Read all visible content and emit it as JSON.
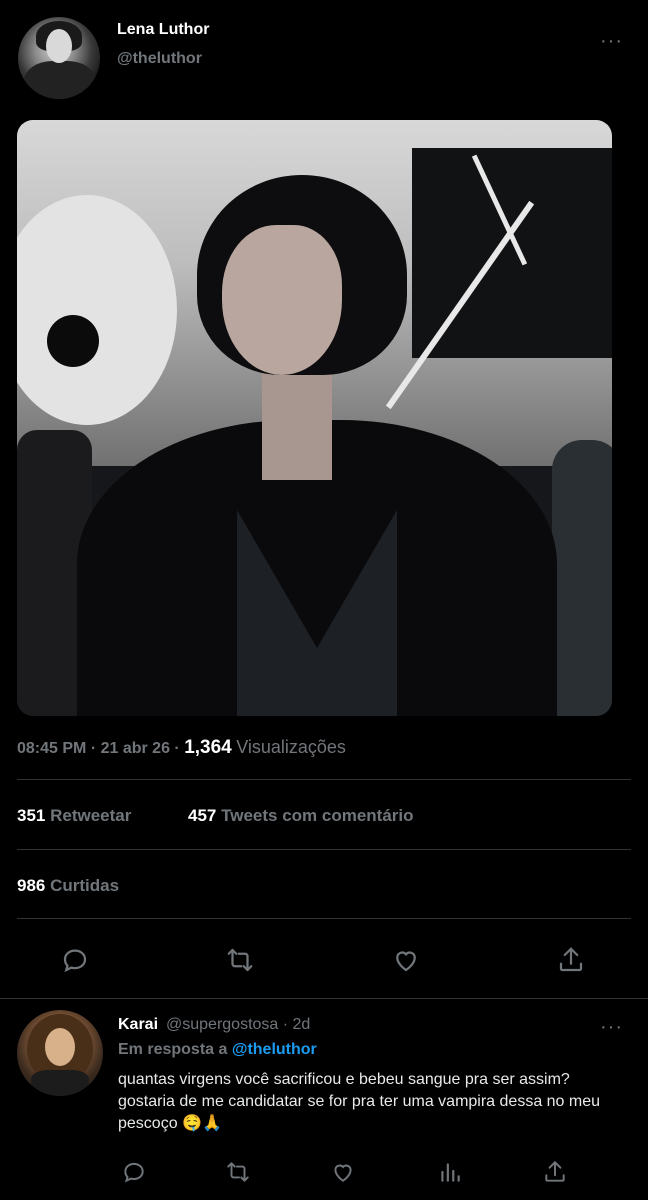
{
  "tweet": {
    "author_name": "Lena Luthor",
    "author_handle": "@theluthor",
    "more_label": "···",
    "time": "08:45 PM · 21 abr 26 ·",
    "views_count": "1,364",
    "views_label": "Visualizações",
    "retweets_count": "351",
    "retweets_label": "Retweetar",
    "quotes_count": "457",
    "quotes_label": "Tweets com comentário",
    "likes_count": "986",
    "likes_label": "Curtidas"
  },
  "actions": {
    "reply_icon": "reply-icon",
    "retweet_icon": "retweet-icon",
    "like_icon": "heart-icon",
    "share_icon": "share-icon"
  },
  "reply": {
    "author_name": "Karai",
    "author_handle": "@supergostosa · 2d",
    "more_label": "···",
    "in_reply_prefix": "Em resposta a",
    "in_reply_mention": "@theluthor",
    "text": "quantas virgens você sacrificou e bebeu sangue pra ser assim? gostaria de me candidatar se for pra ter uma vampira dessa no meu pescoço 🤤🙏"
  },
  "colors": {
    "background": "#000000",
    "text": "#e7e9ea",
    "muted": "#71767b",
    "accent": "#1d9bf0",
    "divider": "#2f3336"
  }
}
